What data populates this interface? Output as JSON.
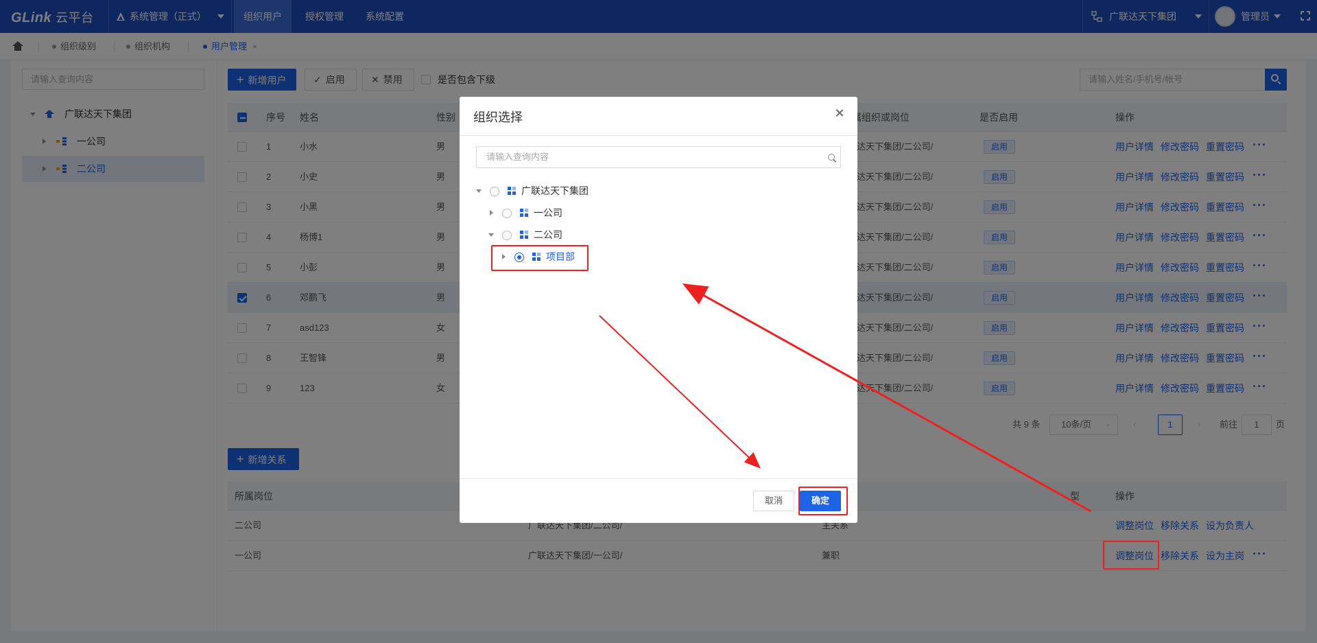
{
  "app": {
    "logo": "GLink",
    "logo_cn": "云平台",
    "system": "系统管理（正式）"
  },
  "nav": {
    "tabs": [
      "组织用户",
      "授权管理",
      "系统配置"
    ],
    "active": 0
  },
  "header": {
    "org": "广联达天下集团",
    "user": "管理员"
  },
  "tags": [
    {
      "label": "组织级别",
      "active": false
    },
    {
      "label": "组织机构",
      "active": false
    },
    {
      "label": "用户管理",
      "active": true,
      "close": "×"
    }
  ],
  "left": {
    "search_placeholder": "请输入查询内容",
    "tree": [
      {
        "label": "广联达天下集团",
        "level": 0,
        "expanded": true
      },
      {
        "label": "一公司",
        "level": 1
      },
      {
        "label": "二公司",
        "level": 1,
        "selected": true
      }
    ]
  },
  "toolbar": {
    "add_user": "新增用户",
    "enable": "启用",
    "disable": "禁用",
    "include_sub": "是否包含下级",
    "search_placeholder": "请输入姓名/手机号/帐号"
  },
  "table": {
    "headers": {
      "index": "序号",
      "name": "姓名",
      "gender": "性别",
      "org": "所属组织或岗位",
      "enabled": "是否启用",
      "ops": "操作"
    },
    "rows": [
      {
        "index": "1",
        "name": "小水",
        "gender": "男",
        "org": "联达天下集团/二公司/",
        "status": "启用",
        "checked": false
      },
      {
        "index": "2",
        "name": "小史",
        "gender": "男",
        "org": "联达天下集团/二公司/",
        "status": "启用",
        "checked": false
      },
      {
        "index": "3",
        "name": "小黑",
        "gender": "男",
        "org": "联达天下集团/二公司/",
        "status": "启用",
        "checked": false
      },
      {
        "index": "4",
        "name": "杨博1",
        "gender": "男",
        "org": "联达天下集团/二公司/",
        "status": "启用",
        "checked": false
      },
      {
        "index": "5",
        "name": "小彭",
        "gender": "男",
        "org": "联达天下集团/二公司/",
        "status": "启用",
        "checked": false
      },
      {
        "index": "6",
        "name": "邓鹏飞",
        "gender": "男",
        "org": "联达天下集团/二公司/",
        "status": "启用",
        "checked": true
      },
      {
        "index": "7",
        "name": "asd123",
        "gender": "女",
        "org": "联达天下集团/二公司/",
        "status": "启用",
        "checked": false
      },
      {
        "index": "8",
        "name": "王智锋",
        "gender": "男",
        "org": "联达天下集团/二公司/",
        "status": "启用",
        "checked": false
      },
      {
        "index": "9",
        "name": "123",
        "gender": "女",
        "org": "联达天下集团/二公司/",
        "status": "启用",
        "checked": false
      }
    ],
    "ops": [
      "用户详情",
      "修改密码",
      "重置密码"
    ],
    "more": "···"
  },
  "pagination": {
    "total": "共 9 条",
    "page_size": "10条/页",
    "current": "1",
    "goto_label": "前往",
    "goto_value": "1",
    "page_suffix": "页"
  },
  "relations": {
    "add": "新增关系",
    "headers": {
      "post": "所属岗位",
      "type": "型",
      "ops": "操作"
    },
    "rows": [
      {
        "post": "二公司",
        "path": "广联达天下集团/二公司/",
        "type": "主关系",
        "ops": [
          "调整岗位",
          "移除关系",
          "设为负责人"
        ],
        "more": ""
      },
      {
        "post": "一公司",
        "path": "广联达天下集团/一公司/",
        "type": "兼职",
        "ops": [
          "调整岗位",
          "移除关系",
          "设为主岗"
        ],
        "more": "···"
      }
    ]
  },
  "modal": {
    "title": "组织选择",
    "search_placeholder": "请输入查询内容",
    "tree": [
      {
        "label": "广联达天下集团",
        "expanded": true,
        "selected": false
      },
      {
        "label": "一公司",
        "expanded": false,
        "selected": false
      },
      {
        "label": "二公司",
        "expanded": true,
        "selected": false
      },
      {
        "label": "项目部",
        "expanded": false,
        "selected": true
      }
    ],
    "cancel": "取消",
    "confirm": "确定"
  },
  "colors": {
    "primary": "#1c63e8",
    "header": "#1c4fbf",
    "annotation": "#ee2020"
  }
}
